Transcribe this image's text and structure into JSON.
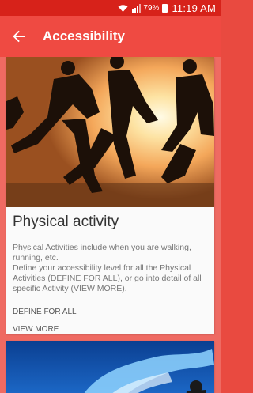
{
  "status_bar": {
    "battery_percent": "79%",
    "time": "11:19 AM",
    "icons": [
      "wifi-icon",
      "signal-icon",
      "battery-icon"
    ]
  },
  "app_bar": {
    "title": "Accessibility",
    "back_icon": "arrow-left-icon"
  },
  "cards": [
    {
      "title": "Physical activity",
      "description": "Physical Activities include when you are walking, running, etc.\nDefine your accessibility level for all the Physical Activities (DEFINE FOR ALL), or go into detail of all specific Activity (VIEW MORE).",
      "actions": [
        "DEFINE FOR ALL",
        "VIEW MORE"
      ]
    }
  ],
  "colors": {
    "status_bar": "#d7221a",
    "app_bar": "#ef4a42",
    "content_bg": "#ef6a62",
    "card_bg": "#fafafa"
  }
}
